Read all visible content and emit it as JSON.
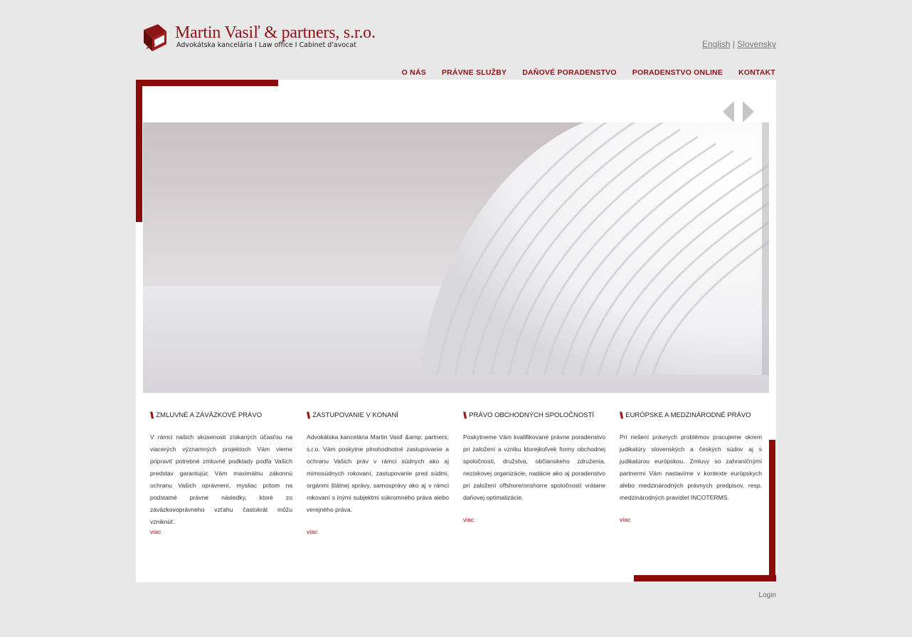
{
  "header": {
    "logo_name": "Martin Vasiľ & partners, s.r.o.",
    "logo_tagline": "Advokátska kancelária  I  Law office  I  Cabinet d'avocat"
  },
  "languages": {
    "english": "English",
    "separator": "|",
    "slovensky": "Slovensky"
  },
  "nav": {
    "items": [
      "O NÁS",
      "PRÁVNE SLUŽBY",
      "DAŇOVÉ PORADENSTVO",
      "PORADENSTVO ONLINE",
      "KONTAKT"
    ]
  },
  "colors": {
    "brand": "#8b1416",
    "accent_bar": "#8b0a0a",
    "background": "#e8e8e8"
  },
  "columns": [
    {
      "title": "ZMLUVNÉ A ZÁVÄZKOVÉ PRÁVO",
      "text": "V rámci našich skúsenosti získaných účasťou na viacerých významných projektoch Vám vieme pripraviť potrebné zmluvné podklady podľa Vašich predstav garantujúc Vám maximálnu zákonnú ochranu Vašich oprávnení, mysliac pritom na podstatné právne následky, ktoré zo záväzkovoprávneho vzťahu častokrát môžu vzniknúť.",
      "more": "viac"
    },
    {
      "title": "ZASTUPOVANIE V KONANÍ",
      "text": "Advokátska kancelária Martin Vasiľ &amp; partners, s.r.o. Vám poskytne plnohodnotné zastupovanie a ochranu Vašich práv v rámci súdnych ako aj mimosúdnych rokovaní, zastupovanie pred súdmi, orgánmi štátnej správy, samosprávy ako aj v rámci rokovaní s inými subjektmi súkromného práva alebo verejného práva.",
      "more": "viac"
    },
    {
      "title": "PRÁVO OBCHODNÝCH SPOLOČNOSTÍ",
      "text": "Poskytneme Vám kvalifikované právne poradenstvo pri založení a vzniku ktorejkoľvek formy obchodnej spoločnosti, družstva, občianskeho združenia, neziskovej organizácie, nadácie ako aj poradenstvo pri založení offshore/onshorre spoločností vrátane daňovej optimalizácie.",
      "more": "viac"
    },
    {
      "title": "EURÓPSKE A MEDZINÁRODNÉ PRÁVO",
      "text": "Pri riešení právnych problémov pracujeme okrem judikatúry slovenských a českých súdov aj s judikatúrou európskou. Zmluvy so zahraničnými partnermi Vám nastavíme v kontexte európskych alebo medzinárodných právnych predpisov, resp. medzinárodných pravidiel INCOTERMS.",
      "more": "viac"
    }
  ],
  "slider": {
    "prev_icon": "arrow-left-icon",
    "next_icon": "arrow-right-icon"
  },
  "footer": {
    "login": "Login"
  }
}
